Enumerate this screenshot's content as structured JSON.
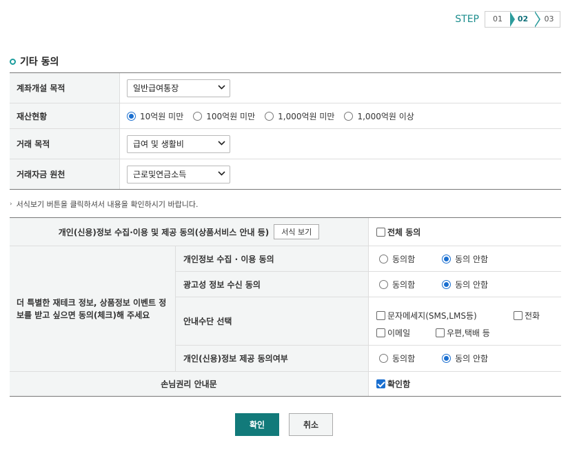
{
  "step": {
    "label": "STEP",
    "items": [
      "01",
      "02",
      "03"
    ],
    "active_index": 1
  },
  "section": {
    "title": "기타 동의"
  },
  "form": {
    "account_purpose": {
      "label": "계좌개설 목적",
      "value": "일반급여통장"
    },
    "assets": {
      "label": "재산현황",
      "options": [
        "10억원 미만",
        "100억원 미만",
        "1,000억원 미만",
        "1,000억원 이상"
      ],
      "selected_index": 0
    },
    "trade_purpose": {
      "label": "거래 목적",
      "value": "급여 및 생활비"
    },
    "fund_source": {
      "label": "거래자금 원천",
      "value": "근로및연금소득"
    }
  },
  "note": "서식보기 버튼을 클릭하셔서 내용을 확인하시기 바랍니다.",
  "consent": {
    "header": "개인(신용)정보 수집·이용 및 제공 동의(상품서비스 안내 등)",
    "view_form_button": "서식 보기",
    "all_agree_label": "전체 동의",
    "all_agree_checked": false,
    "side_text": "더 특별한 재테크 정보, 상품정보 이벤트 정보를 받고 싶으면 동의(체크)해 주세요",
    "rows": [
      {
        "label": "개인정보 수집 · 이용 동의",
        "options": [
          "동의함",
          "동의 안함"
        ],
        "selected_index": 1
      },
      {
        "label": "광고성 정보 수신 동의",
        "options": [
          "동의함",
          "동의 안함"
        ],
        "selected_index": 1
      },
      {
        "label": "개인(신용)정보 제공 동의여부",
        "options": [
          "동의함",
          "동의 안함"
        ],
        "selected_index": 1
      }
    ],
    "channel": {
      "label": "안내수단 선택",
      "options": [
        {
          "label": "문자메세지(SMS,LMS등)",
          "checked": false
        },
        {
          "label": "전화",
          "checked": false
        },
        {
          "label": "이메일",
          "checked": false
        },
        {
          "label": "우편,택배 등",
          "checked": false
        }
      ]
    },
    "rights": {
      "label": "손님권리 안내문",
      "check_label": "확인함",
      "checked": true
    }
  },
  "buttons": {
    "confirm": "확인",
    "cancel": "취소"
  },
  "colors": {
    "accent": "#127a7a",
    "radio_selected": "#1a6fd0",
    "header_bg": "#f3f5f5"
  }
}
